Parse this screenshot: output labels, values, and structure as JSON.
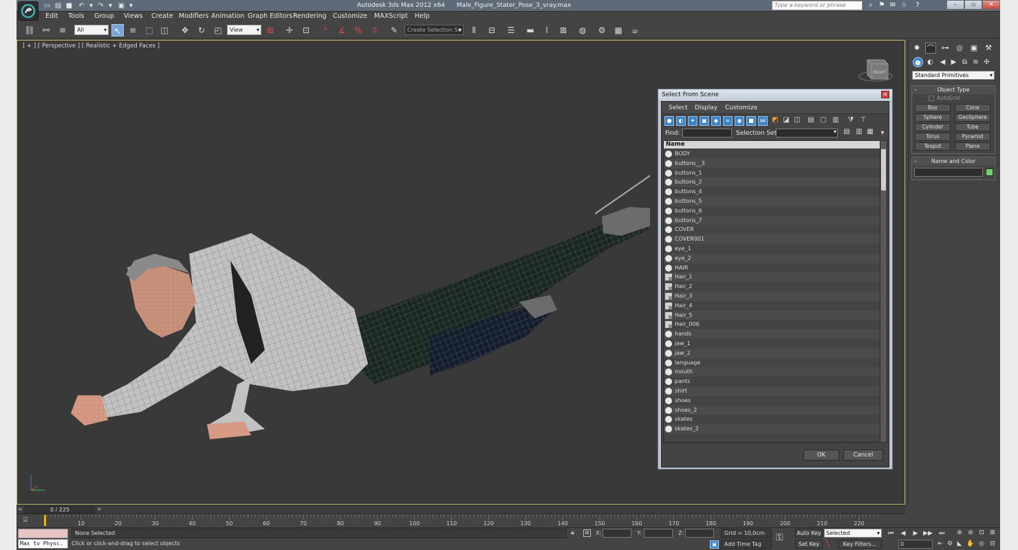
{
  "app": {
    "title": "Autodesk 3ds Max  2012 x64",
    "file": "Male_Figure_Stater_Pose_3_vray.max",
    "search_placeholder": "Type a keyword or phrase"
  },
  "menu": [
    "Edit",
    "Tools",
    "Group",
    "Views",
    "Create",
    "Modifiers",
    "Animation",
    "Graph Editors",
    "Rendering",
    "Customize",
    "MAXScript",
    "Help"
  ],
  "toolbar": {
    "filter_value": "All",
    "refcoord_value": "View",
    "selection_set_placeholder": "Create Selection Se"
  },
  "viewport": {
    "label": "[ + ] [ Perspective ] [ Realistic + Edged Faces ]",
    "viewcube_face": "RIGHT"
  },
  "dialog": {
    "title": "Select From Scene",
    "menu": [
      "Select",
      "Display",
      "Customize"
    ],
    "find_label": "Find:",
    "selection_set_label": "Selection Set:",
    "column_name": "Name",
    "items": [
      {
        "name": "BODY",
        "multi": false
      },
      {
        "name": "buttons__3",
        "multi": false
      },
      {
        "name": "buttons_1",
        "multi": false
      },
      {
        "name": "buttons_2",
        "multi": false
      },
      {
        "name": "buttons_4",
        "multi": false
      },
      {
        "name": "buttons_5",
        "multi": false
      },
      {
        "name": "buttons_6",
        "multi": false
      },
      {
        "name": "buttons_7",
        "multi": false
      },
      {
        "name": "COVER",
        "multi": false
      },
      {
        "name": "COVER001",
        "multi": false
      },
      {
        "name": "eye_1",
        "multi": false
      },
      {
        "name": "eye_2",
        "multi": false
      },
      {
        "name": "HAIR",
        "multi": false
      },
      {
        "name": "Hair_1",
        "multi": true
      },
      {
        "name": "Hair_2",
        "multi": true
      },
      {
        "name": "Hair_3",
        "multi": true
      },
      {
        "name": "Hair_4",
        "multi": true
      },
      {
        "name": "Hair_5",
        "multi": true
      },
      {
        "name": "Hair_006",
        "multi": true
      },
      {
        "name": "hands",
        "multi": false
      },
      {
        "name": "jaw_1",
        "multi": false
      },
      {
        "name": "jaw_2",
        "multi": false
      },
      {
        "name": "language",
        "multi": false
      },
      {
        "name": "mouth",
        "multi": false
      },
      {
        "name": "pants",
        "multi": false
      },
      {
        "name": "shirt",
        "multi": false
      },
      {
        "name": "shoes",
        "multi": false
      },
      {
        "name": "shoes_2",
        "multi": false
      },
      {
        "name": "skates",
        "multi": false
      },
      {
        "name": "skates_2",
        "multi": false
      }
    ],
    "ok_label": "OK",
    "cancel_label": "Cancel"
  },
  "command_panel": {
    "dropdown": "Standard Primitives",
    "object_type_title": "Object Type",
    "autogrid_label": "AutoGrid",
    "primitives": [
      "Box",
      "Cone",
      "Sphere",
      "GeoSphere",
      "Cylinder",
      "Tube",
      "Torus",
      "Pyramid",
      "Teapot",
      "Plane"
    ],
    "name_color_title": "Name and Color",
    "object_color": "#70d470"
  },
  "timeline": {
    "current": "0 / 225",
    "ticks": [
      "10",
      "20",
      "30",
      "40",
      "50",
      "60",
      "70",
      "80",
      "90",
      "100",
      "110",
      "120",
      "130",
      "140",
      "150",
      "160",
      "170",
      "180",
      "190",
      "200",
      "210",
      "220"
    ]
  },
  "status": {
    "maxscript": "Max to Physc.",
    "selection": "None Selected",
    "prompt": "Click or click-and-drag to select objects",
    "x_label": "X:",
    "y_label": "Y:",
    "z_label": "Z:",
    "grid": "Grid = 10,0cm",
    "add_time_tag": "Add Time Tag",
    "auto_key": "Auto Key",
    "set_key": "Set Key",
    "selected_dd": "Selected",
    "key_filters": "Key Filters...",
    "frame": "0"
  }
}
